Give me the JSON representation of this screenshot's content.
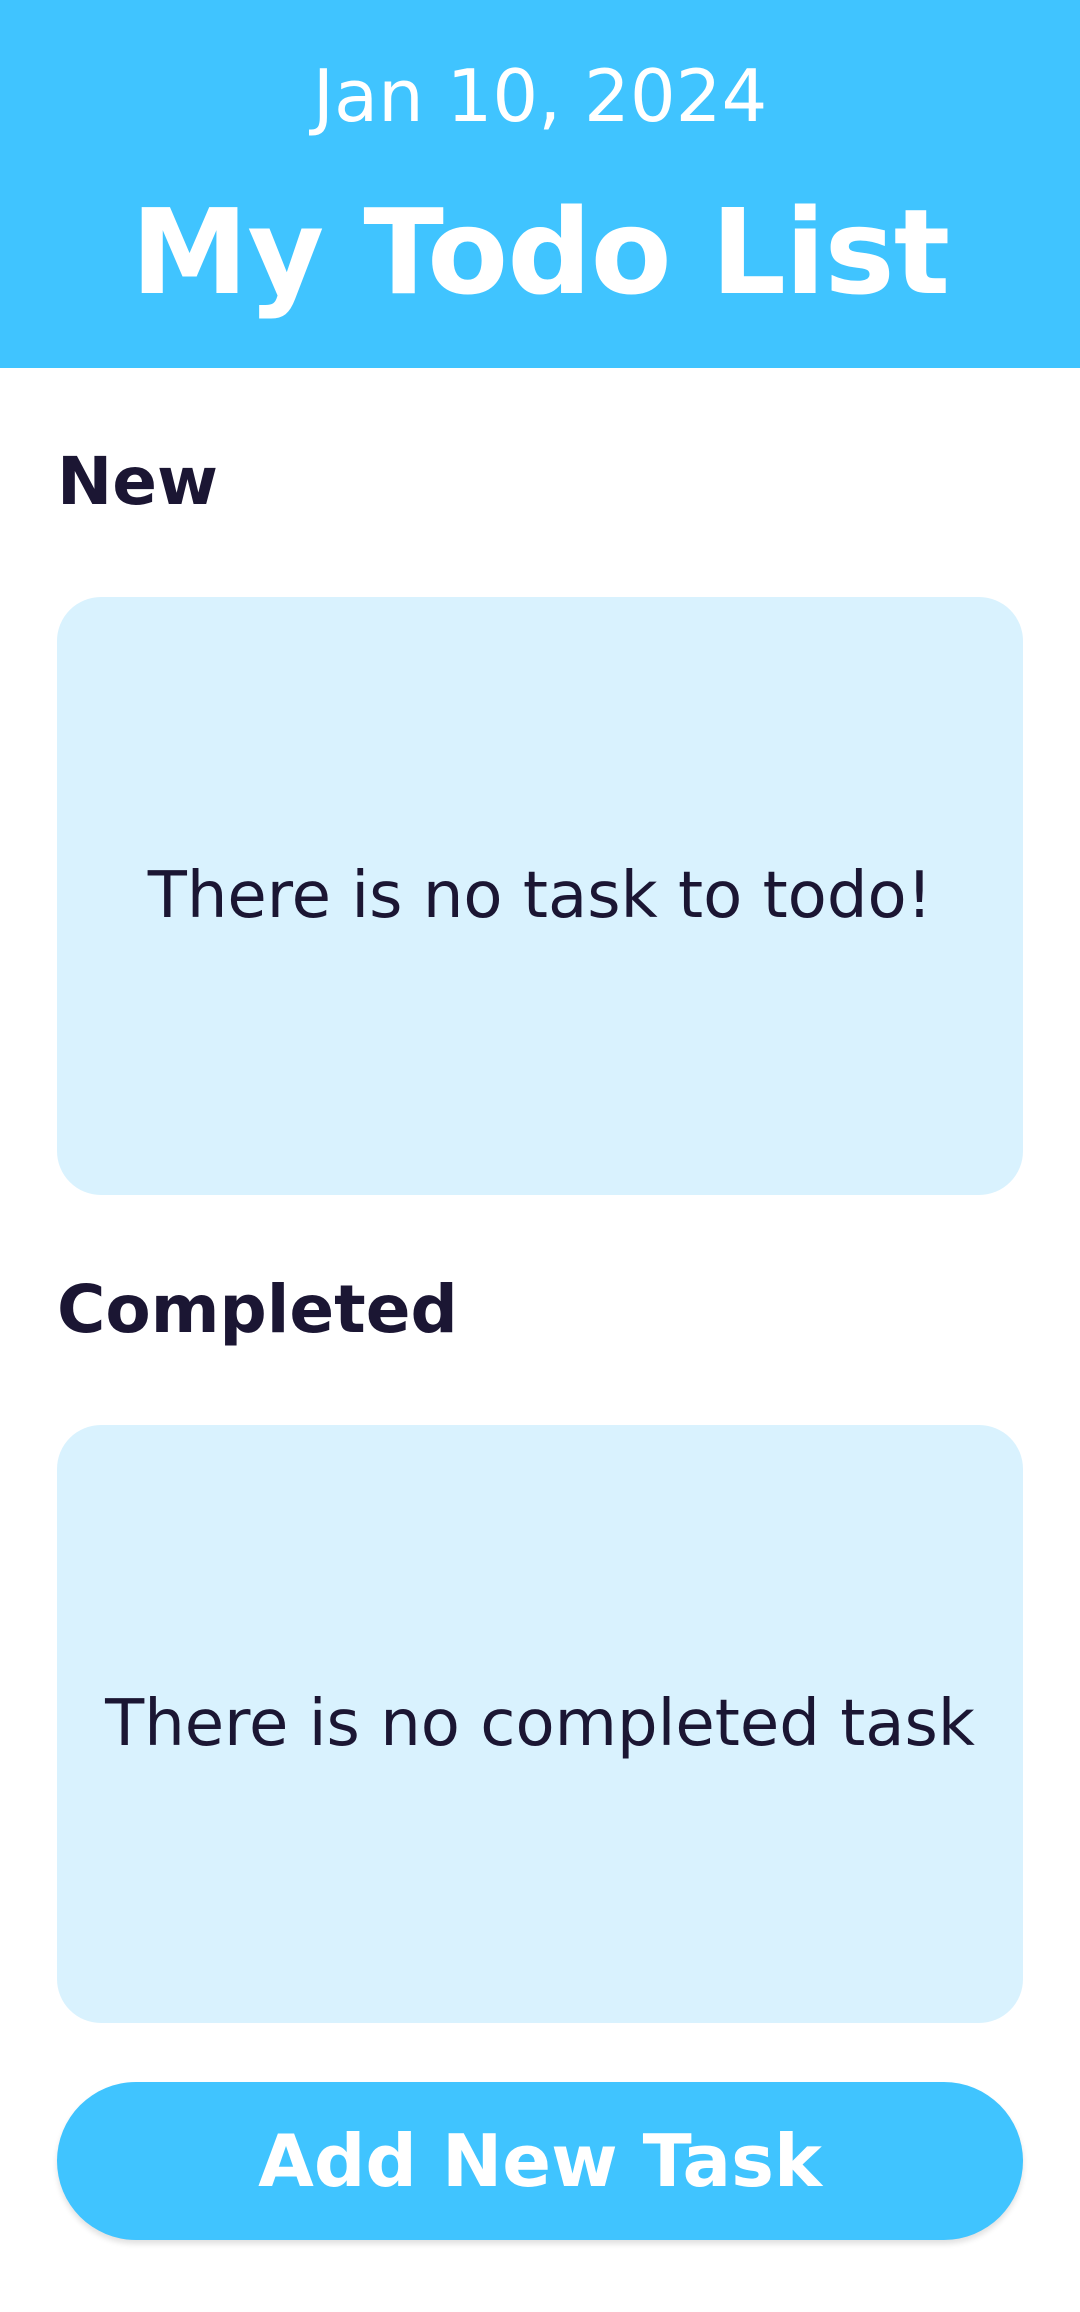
{
  "header": {
    "date": "Jan 10, 2024",
    "title": "My Todo List"
  },
  "sections": {
    "new": {
      "heading": "New",
      "empty_message": "There is no task to todo!"
    },
    "completed": {
      "heading": "Completed",
      "empty_message": "There is no completed task"
    }
  },
  "actions": {
    "add_task_label": "Add New Task"
  },
  "colors": {
    "accent": "#40c4ff",
    "panel": "#d9f2fe",
    "text": "#1b1633",
    "background": "#ffffff"
  }
}
